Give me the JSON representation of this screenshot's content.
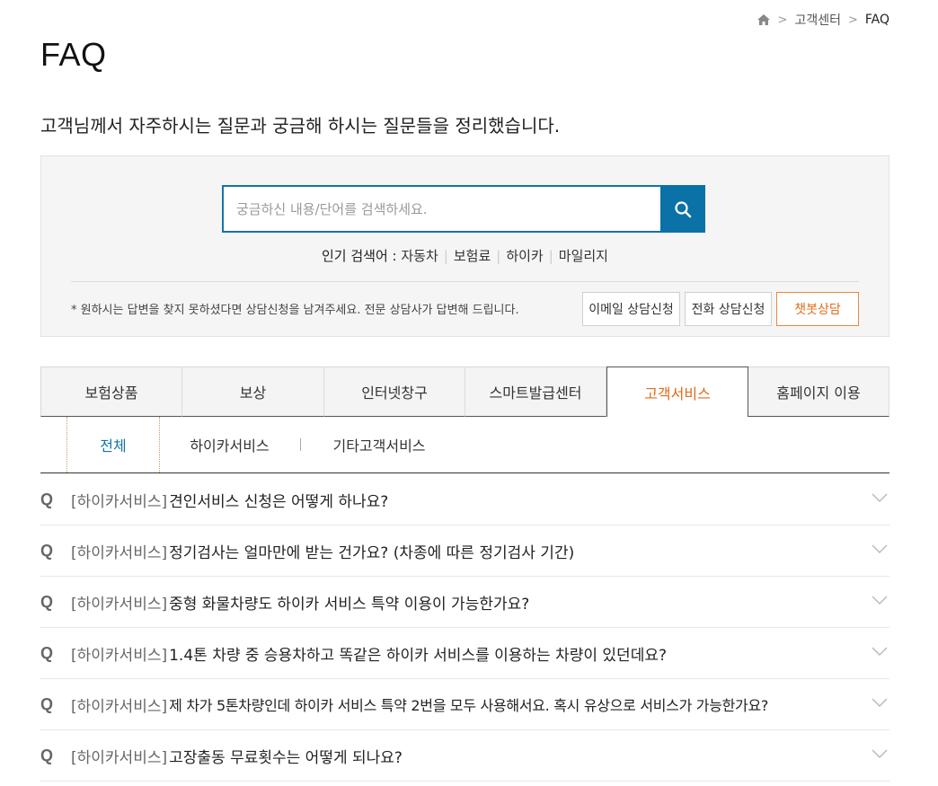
{
  "breadcrumb": {
    "home_icon": "home-icon",
    "items": [
      "고객센터",
      "FAQ"
    ]
  },
  "page": {
    "title": "FAQ",
    "intro": "고객님께서 자주하시는 질문과 궁금해 하시는 질문들을 정리했습니다."
  },
  "search": {
    "placeholder": "궁금하신 내용/단어를 검색하세요.",
    "button_icon": "search-icon",
    "popular_label": "인기 검색어 :",
    "popular": [
      "자동차",
      "보험료",
      "하이카",
      "마일리지"
    ]
  },
  "consult": {
    "note": "* 원하시는 답변을 찾지 못하셨다면 상담신청을 남겨주세요. 전문 상담사가 답변해 드립니다.",
    "email_button": "이메일 상담신청",
    "phone_button": "전화 상담신청",
    "chat_button": "챗봇상담"
  },
  "tabs": [
    {
      "label": "보험상품",
      "active": false
    },
    {
      "label": "보상",
      "active": false
    },
    {
      "label": "인터넷창구",
      "active": false
    },
    {
      "label": "스마트발급센터",
      "active": false
    },
    {
      "label": "고객서비스",
      "active": true
    },
    {
      "label": "홈페이지 이용",
      "active": false
    }
  ],
  "subtabs": [
    {
      "label": "전체",
      "active": true
    },
    {
      "label": "하이카서비스",
      "active": false
    },
    {
      "label": "기타고객서비스",
      "active": false
    }
  ],
  "faq": {
    "q_marker": "Q",
    "items": [
      {
        "category": "[하이카서비스]",
        "question": "견인서비스 신청은 어떻게 하나요?"
      },
      {
        "category": "[하이카서비스]",
        "question": "정기검사는 얼마만에 받는 건가요? (차종에 따른 정기검사 기간)"
      },
      {
        "category": "[하이카서비스]",
        "question": "중형 화물차량도 하이카 서비스 특약 이용이 가능한가요?"
      },
      {
        "category": "[하이카서비스]",
        "question": "1.4톤 차량 중 승용차하고 똑같은 하이카 서비스를 이용하는 차량이 있던데요?"
      },
      {
        "category": "[하이카서비스]",
        "question": "제 차가 5톤차량인데 하이카 서비스 특약 2번을 모두 사용해서요. 혹시 유상으로 서비스가 가능한가요?"
      },
      {
        "category": "[하이카서비스]",
        "question": "고장출동 무료횟수는 어떻게 되나요?"
      }
    ]
  },
  "colors": {
    "accent_blue": "#0a72a6",
    "accent_orange": "#e06a1a"
  }
}
